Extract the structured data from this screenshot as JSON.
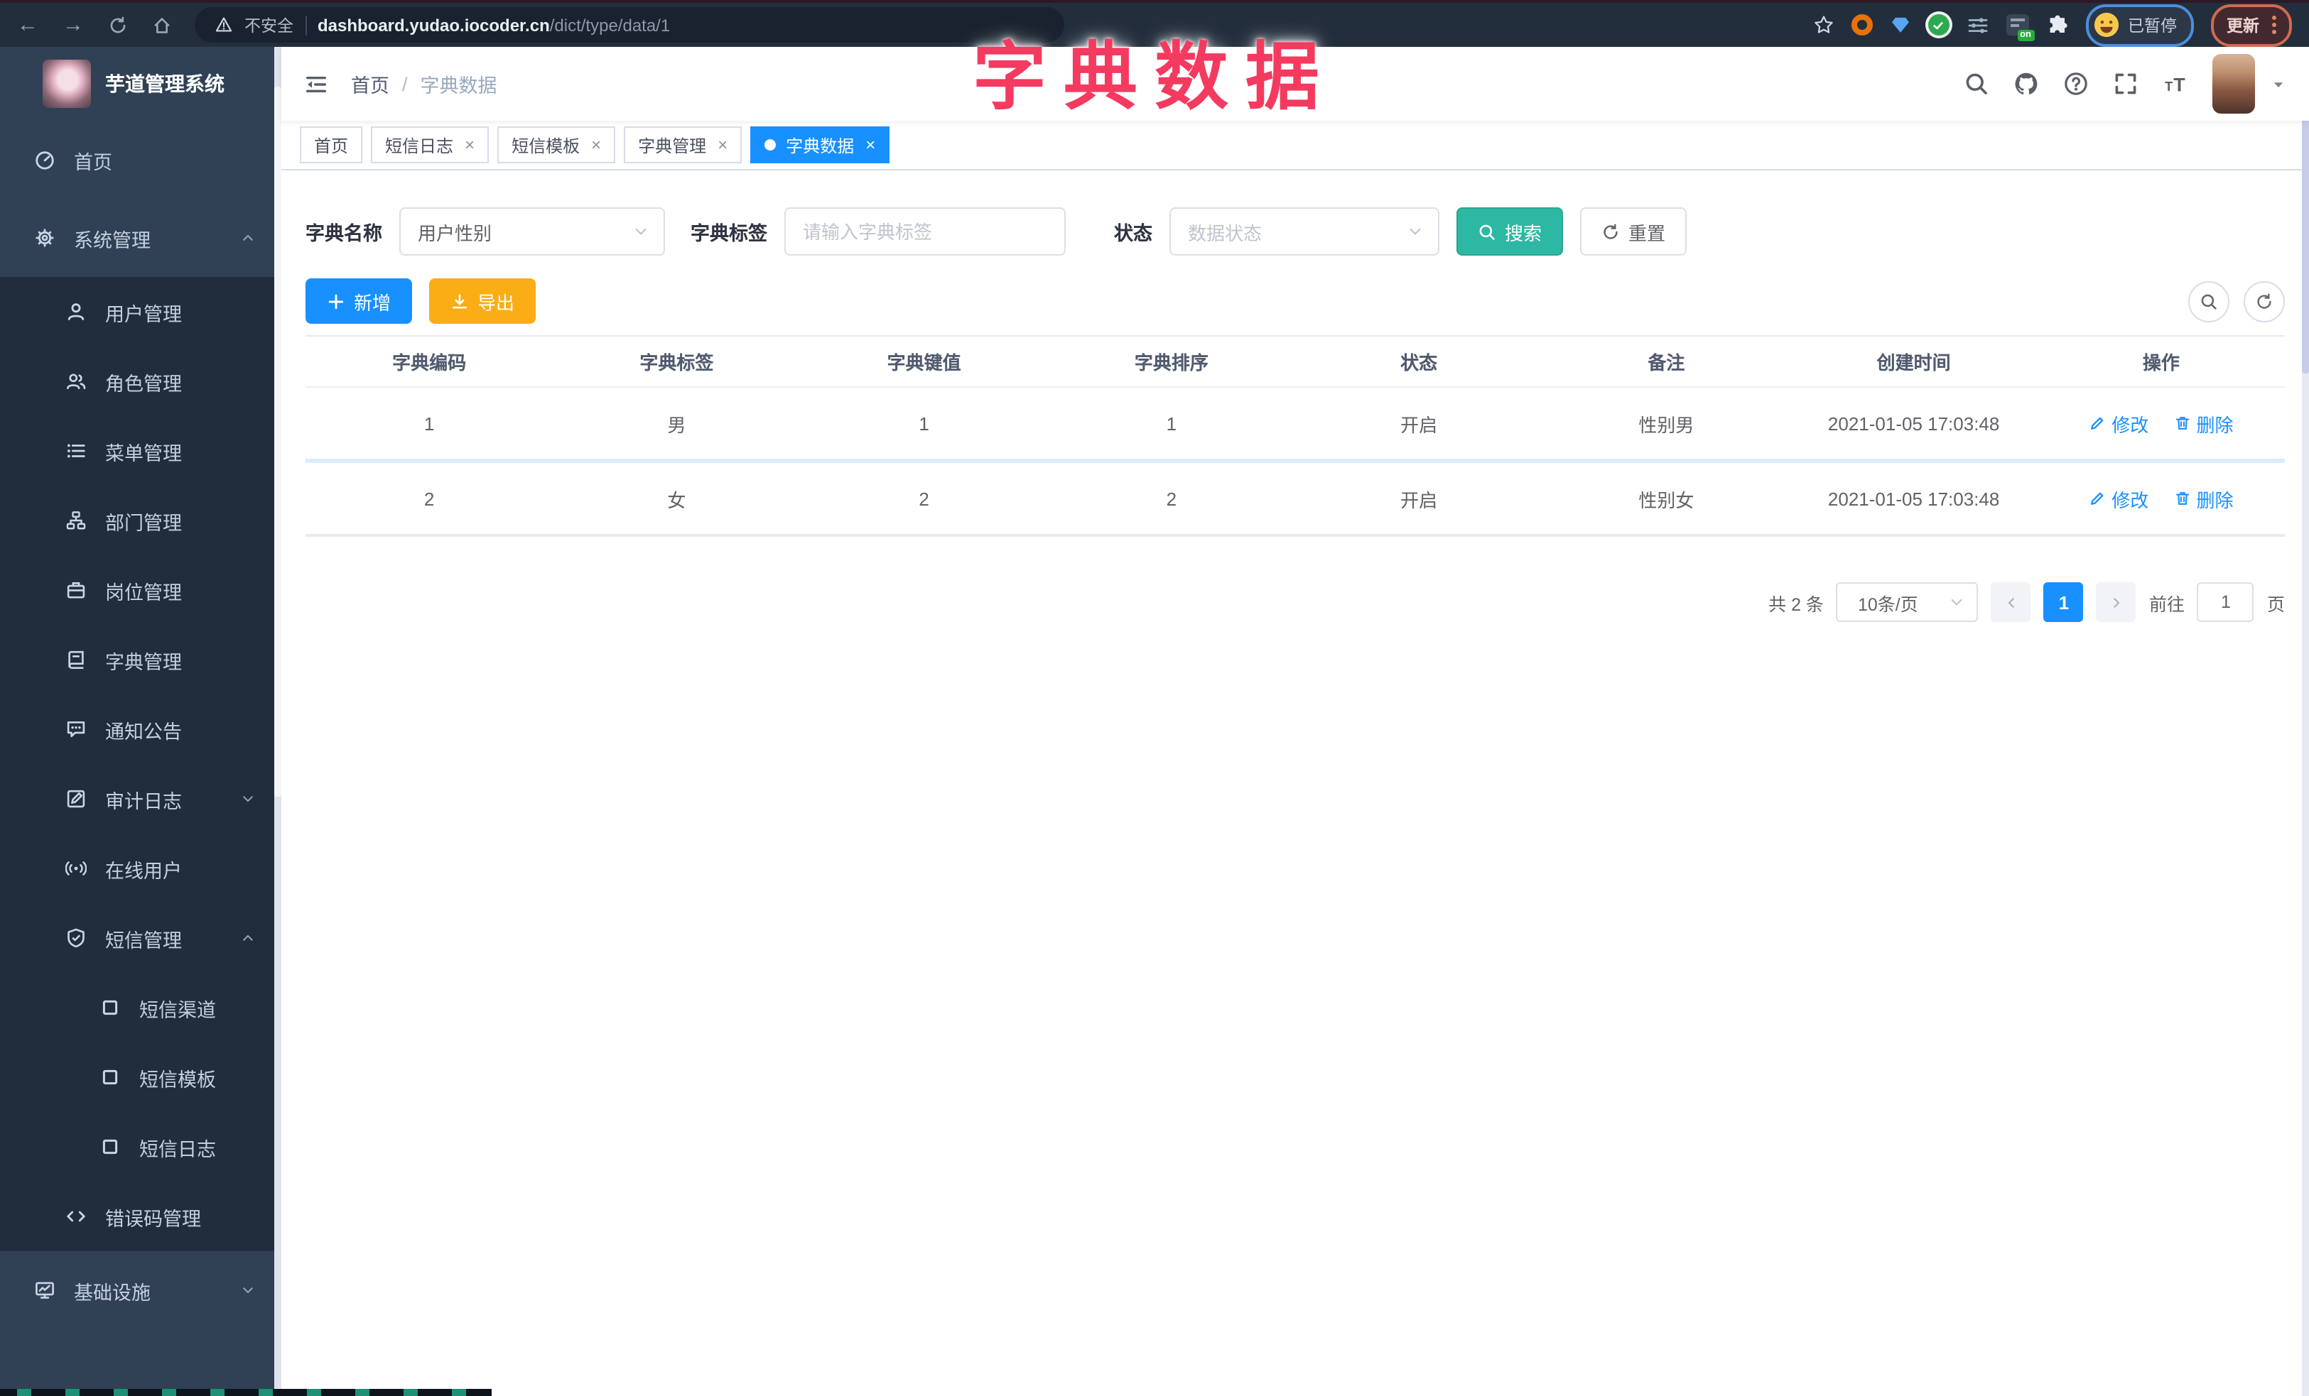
{
  "browser": {
    "security_label": "不安全",
    "url_domain": "dashboard.yudao.iocoder.cn",
    "url_path": "/dict/type/data/1",
    "extension_badge": "on",
    "profile_status": "已暂停",
    "update_label": "更新"
  },
  "overlay_title": "字典数据",
  "sidebar": {
    "app_title": "芋道管理系统",
    "items": [
      {
        "label": "首页"
      },
      {
        "label": "系统管理"
      },
      {
        "label": "用户管理"
      },
      {
        "label": "角色管理"
      },
      {
        "label": "菜单管理"
      },
      {
        "label": "部门管理"
      },
      {
        "label": "岗位管理"
      },
      {
        "label": "字典管理"
      },
      {
        "label": "通知公告"
      },
      {
        "label": "审计日志"
      },
      {
        "label": "在线用户"
      },
      {
        "label": "短信管理"
      },
      {
        "label": "短信渠道"
      },
      {
        "label": "短信模板"
      },
      {
        "label": "短信日志"
      },
      {
        "label": "错误码管理"
      },
      {
        "label": "基础设施"
      }
    ]
  },
  "header": {
    "breadcrumb": [
      "首页",
      "字典数据"
    ],
    "separator": "/"
  },
  "tabs": [
    {
      "label": "首页"
    },
    {
      "label": "短信日志"
    },
    {
      "label": "短信模板"
    },
    {
      "label": "字典管理"
    },
    {
      "label": "字典数据"
    }
  ],
  "filters": {
    "dict_name_label": "字典名称",
    "dict_name_value": "用户性别",
    "dict_label_label": "字典标签",
    "dict_label_placeholder": "请输入字典标签",
    "status_label": "状态",
    "status_placeholder": "数据状态",
    "search_label": "搜索",
    "reset_label": "重置"
  },
  "toolbar": {
    "add_label": "新增",
    "export_label": "导出"
  },
  "table": {
    "headers": [
      "字典编码",
      "字典标签",
      "字典键值",
      "字典排序",
      "状态",
      "备注",
      "创建时间",
      "操作"
    ],
    "rows": [
      [
        "1",
        "男",
        "1",
        "1",
        "开启",
        "性别男",
        "2021-01-05 17:03:48"
      ],
      [
        "2",
        "女",
        "2",
        "2",
        "开启",
        "性别女",
        "2021-01-05 17:03:48"
      ]
    ],
    "edit_label": "修改",
    "delete_label": "删除"
  },
  "pagination": {
    "total": "共 2 条",
    "page_size": "10条/页",
    "page": "1",
    "goto_prefix": "前往",
    "goto_value": "1",
    "goto_suffix": "页"
  },
  "colors": {
    "primary": "#1890ff",
    "teal": "#2db8a3",
    "warning": "#faad14",
    "sidebar_bg": "#304156",
    "sidebar_sub_bg": "#1f2d3d",
    "annotation": "#f43a5f"
  }
}
